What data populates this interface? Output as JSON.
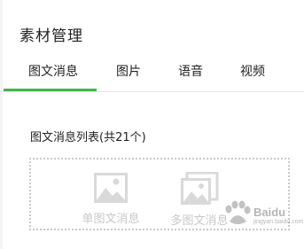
{
  "page": {
    "title": "素材管理"
  },
  "tabs": [
    {
      "label": "图文消息",
      "active": true
    },
    {
      "label": "图片",
      "active": false
    },
    {
      "label": "语音",
      "active": false
    },
    {
      "label": "视频",
      "active": false
    }
  ],
  "list": {
    "header": "图文消息列表(共21个)"
  },
  "create": {
    "single": {
      "label": "单图文消息",
      "icon": "image-placeholder-icon"
    },
    "multi": {
      "label": "多图文消息",
      "icon": "stacked-images-icon"
    }
  },
  "watermark": {
    "text": "Baidu",
    "sub": "jingyan.baidu.com"
  },
  "colors": {
    "accent": "#44b549",
    "placeholder_gray": "#d9d9d9",
    "label_gray": "#c8c8c8",
    "border_dotted": "#c9c9c9"
  }
}
